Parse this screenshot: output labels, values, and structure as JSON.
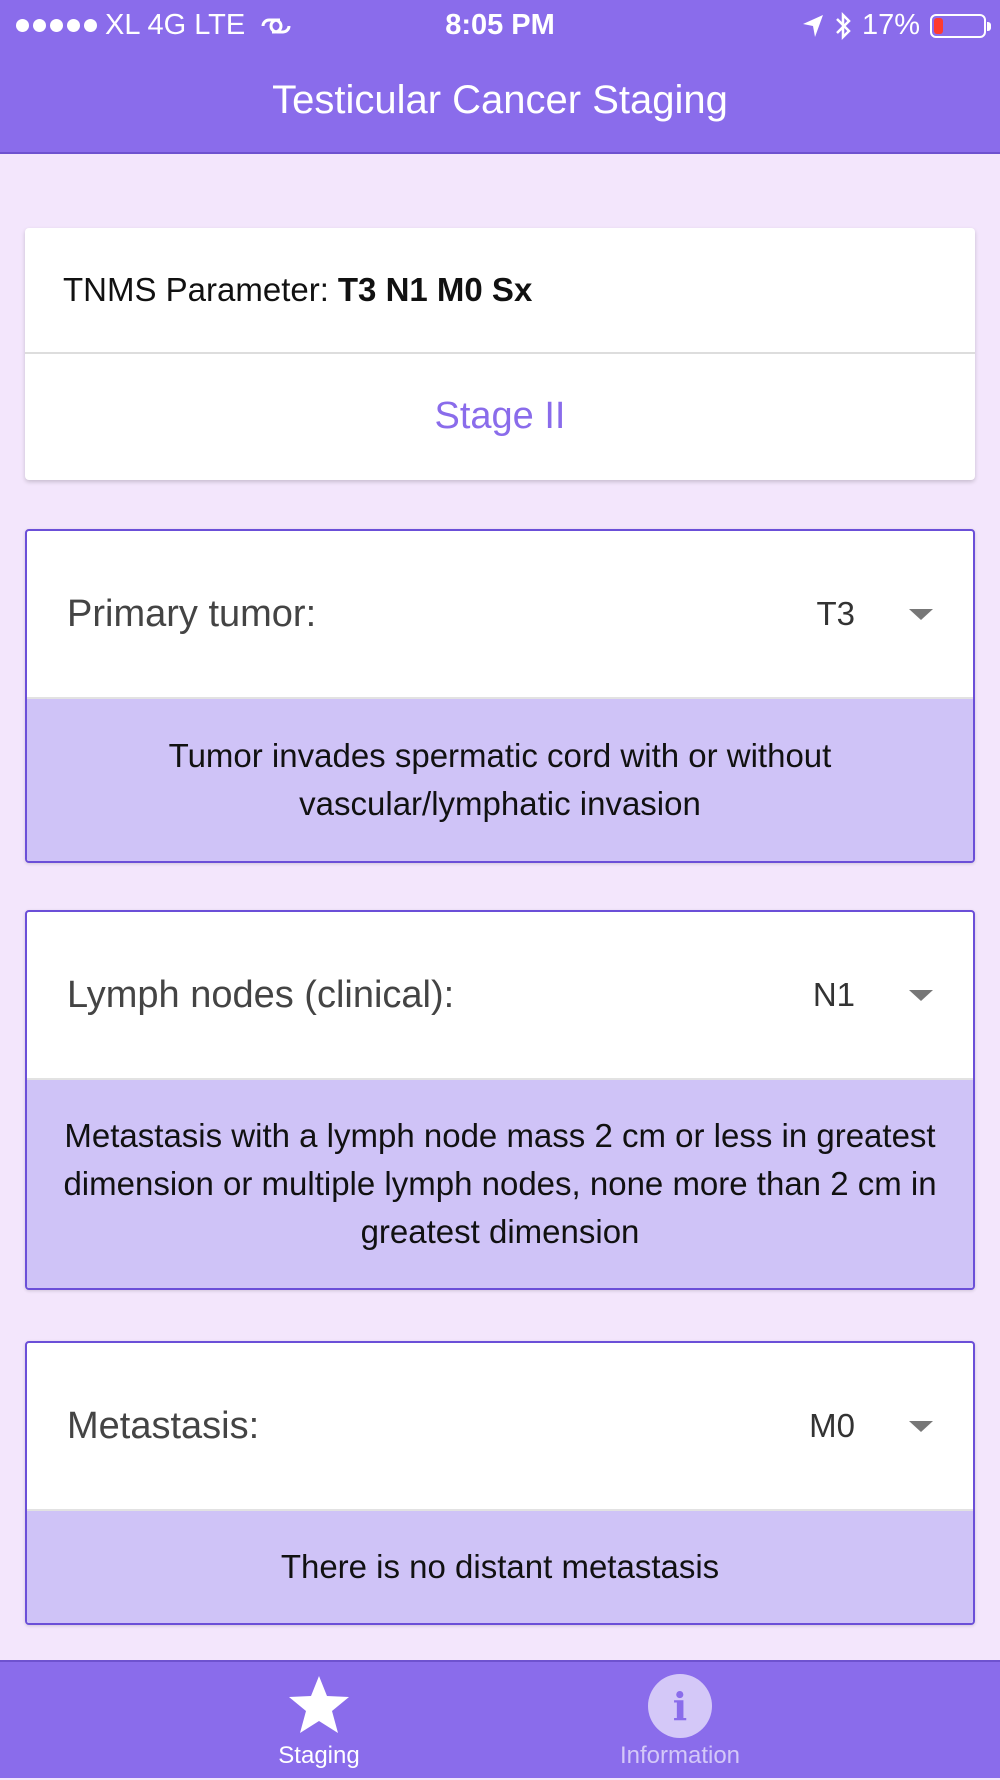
{
  "status_bar": {
    "carrier": "XL 4G LTE",
    "time": "8:05 PM",
    "battery": "17%",
    "battery_level": 0.17
  },
  "header": {
    "title": "Testicular Cancer Staging"
  },
  "summary": {
    "param_label": "TNMS Parameter:",
    "param_value": "T3 N1 M0 Sx",
    "stage": "Stage II"
  },
  "cards": [
    {
      "label": "Primary tumor:",
      "value": "T3",
      "description": "Tumor invades spermatic cord with or without vascular/lymphatic invasion"
    },
    {
      "label": "Lymph nodes (clinical):",
      "value": "N1",
      "description": "Metastasis with a lymph node mass 2 cm or less in greatest dimension or multiple lymph nodes, none more than 2 cm in greatest dimension"
    },
    {
      "label": "Metastasis:",
      "value": "M0",
      "description": "There is no distant metastasis"
    }
  ],
  "tabs": [
    {
      "label": "Staging",
      "icon": "star-icon",
      "active": true
    },
    {
      "label": "Information",
      "icon": "info-icon",
      "active": false
    }
  ],
  "colors": {
    "primary": "#8a6ceb",
    "background": "#f3e6fc",
    "description_bg": "#cfc3f7",
    "card_border": "#6b4fd8"
  }
}
